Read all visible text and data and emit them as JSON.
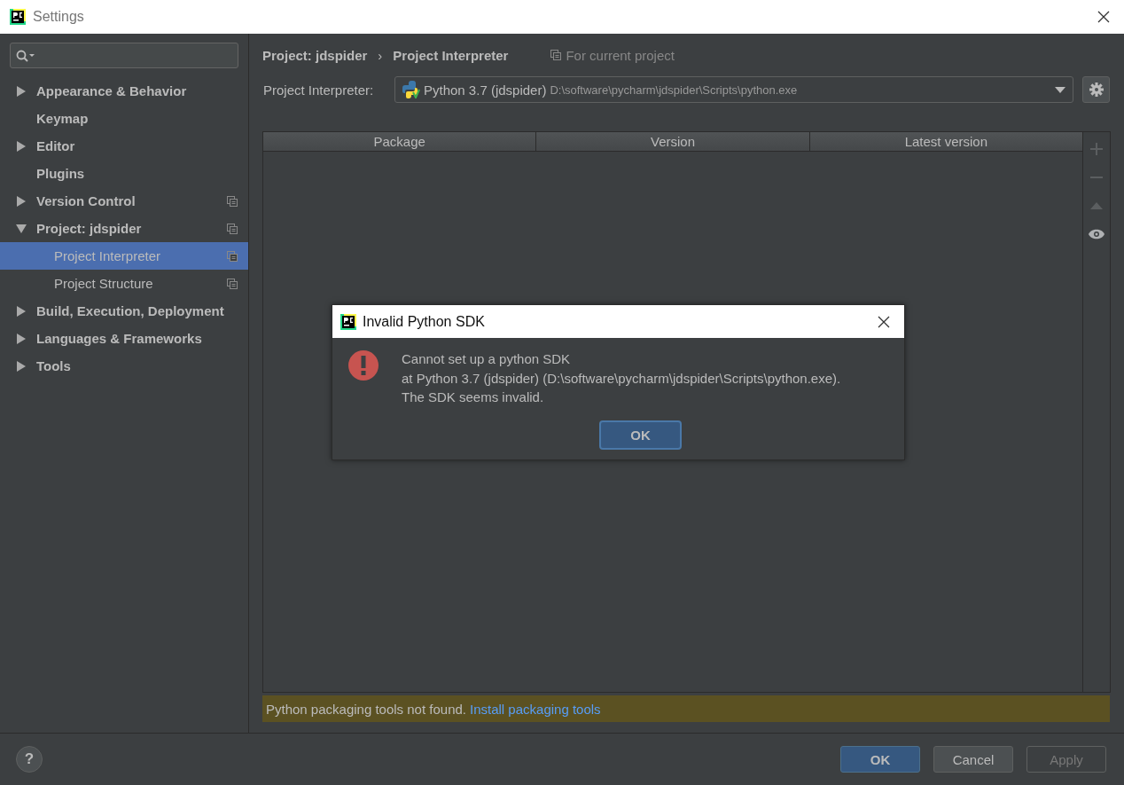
{
  "window": {
    "title": "Settings"
  },
  "sidebar": {
    "items": [
      {
        "label": "Appearance & Behavior",
        "kind": "group",
        "expanded": false,
        "selected": false,
        "per_project": false
      },
      {
        "label": "Keymap",
        "kind": "leaf",
        "selected": false,
        "per_project": false
      },
      {
        "label": "Editor",
        "kind": "group",
        "expanded": false,
        "selected": false,
        "per_project": false
      },
      {
        "label": "Plugins",
        "kind": "leaf",
        "selected": false,
        "per_project": false
      },
      {
        "label": "Version Control",
        "kind": "group",
        "expanded": false,
        "selected": false,
        "per_project": true
      },
      {
        "label": "Project: jdspider",
        "kind": "group",
        "expanded": true,
        "selected": false,
        "per_project": true,
        "children": [
          {
            "label": "Project Interpreter",
            "selected": true,
            "per_project": true
          },
          {
            "label": "Project Structure",
            "selected": false,
            "per_project": true
          }
        ]
      },
      {
        "label": "Build, Execution, Deployment",
        "kind": "group",
        "expanded": false,
        "selected": false,
        "per_project": false
      },
      {
        "label": "Languages & Frameworks",
        "kind": "group",
        "expanded": false,
        "selected": false,
        "per_project": false
      },
      {
        "label": "Tools",
        "kind": "group",
        "expanded": false,
        "selected": false,
        "per_project": false
      }
    ]
  },
  "breadcrumb": [
    "Project: jdspider",
    "Project Interpreter"
  ],
  "breadcrumb_separator": "›",
  "scope_note": "For current project",
  "interpreter": {
    "label": "Project Interpreter:",
    "name": "Python 3.7 (jdspider)",
    "path": "D:\\software\\pycharm\\jdspider\\Scripts\\python.exe"
  },
  "table": {
    "columns": [
      "Package",
      "Version",
      "Latest version"
    ]
  },
  "table_tools": [
    {
      "kind": "add",
      "disabled": true
    },
    {
      "kind": "remove",
      "disabled": true
    },
    {
      "kind": "up",
      "disabled": true
    },
    {
      "kind": "show",
      "disabled": false
    }
  ],
  "warning": {
    "text": "Python packaging tools not found.",
    "link": "Install packaging tools"
  },
  "buttons": [
    {
      "label": "OK",
      "default": true,
      "disabled": false
    },
    {
      "label": "Cancel",
      "default": false,
      "disabled": false
    },
    {
      "label": "Apply",
      "default": false,
      "disabled": true
    }
  ],
  "help": "?",
  "dialog": {
    "title": "Invalid Python SDK",
    "lines": [
      "Cannot set up a python SDK",
      "at Python 3.7 (jdspider) (D:\\software\\pycharm\\jdspider\\Scripts\\python.exe).",
      "The SDK seems invalid."
    ],
    "button": "OK"
  }
}
